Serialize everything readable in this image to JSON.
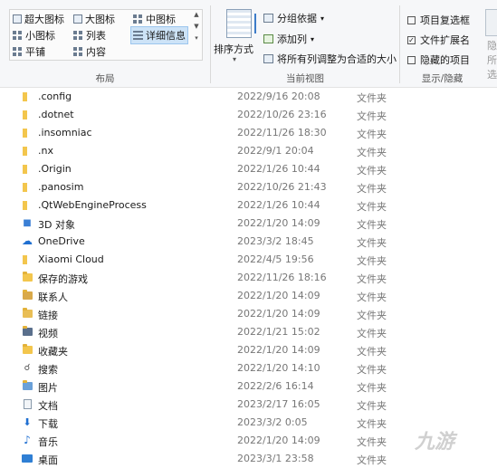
{
  "ribbon": {
    "layout": {
      "group_label": "布局",
      "options": [
        {
          "label": "超大图标",
          "icon": "extra-large-icons-icon"
        },
        {
          "label": "大图标",
          "icon": "large-icons-icon"
        },
        {
          "label": "中图标",
          "icon": "medium-icons-icon"
        },
        {
          "label": "小图标",
          "icon": "small-icons-icon"
        },
        {
          "label": "列表",
          "icon": "list-view-icon"
        },
        {
          "label": "详细信息",
          "icon": "details-view-icon",
          "selected": true
        },
        {
          "label": "平铺",
          "icon": "tiles-view-icon"
        },
        {
          "label": "内容",
          "icon": "content-view-icon"
        }
      ]
    },
    "current_view": {
      "group_label": "当前视图",
      "sort_label": "排序方式",
      "group_by_label": "分组依据",
      "add_column_label": "添加列",
      "fit_columns_label": "将所有列调整为合适的大小"
    },
    "show_hide": {
      "group_label": "显示/隐藏",
      "item_checkboxes_label": "项目复选框",
      "item_checkboxes_checked": false,
      "file_extensions_label": "文件扩展名",
      "file_extensions_checked": true,
      "hidden_items_label": "隐藏的项目",
      "hidden_items_checked": false,
      "hide_selected_label": "隐",
      "selected_items_label": "所选"
    }
  },
  "files": [
    {
      "name": ".config",
      "date": "2022/9/16 20:08",
      "type": "文件夹",
      "icon": "folder-icon"
    },
    {
      "name": ".dotnet",
      "date": "2022/10/26 23:16",
      "type": "文件夹",
      "icon": "folder-icon"
    },
    {
      "name": ".insomniac",
      "date": "2022/11/26 18:30",
      "type": "文件夹",
      "icon": "folder-icon"
    },
    {
      "name": ".nx",
      "date": "2022/9/1 20:04",
      "type": "文件夹",
      "icon": "folder-icon"
    },
    {
      "name": ".Origin",
      "date": "2022/1/26 10:44",
      "type": "文件夹",
      "icon": "folder-icon"
    },
    {
      "name": ".panosim",
      "date": "2022/10/26 21:43",
      "type": "文件夹",
      "icon": "folder-icon"
    },
    {
      "name": ".QtWebEngineProcess",
      "date": "2022/1/26 10:44",
      "type": "文件夹",
      "icon": "folder-icon"
    },
    {
      "name": "3D 对象",
      "date": "2022/1/20 14:09",
      "type": "文件夹",
      "icon": "3d-objects-icon"
    },
    {
      "name": "OneDrive",
      "date": "2023/3/2 18:45",
      "type": "文件夹",
      "icon": "onedrive-cloud-icon"
    },
    {
      "name": "Xiaomi Cloud",
      "date": "2022/4/5 19:56",
      "type": "文件夹",
      "icon": "folder-icon"
    },
    {
      "name": "保存的游戏",
      "date": "2022/11/26 18:16",
      "type": "文件夹",
      "icon": "saved-games-icon"
    },
    {
      "name": "联系人",
      "date": "2022/1/20 14:09",
      "type": "文件夹",
      "icon": "contacts-icon"
    },
    {
      "name": "链接",
      "date": "2022/1/20 14:09",
      "type": "文件夹",
      "icon": "links-icon"
    },
    {
      "name": "视频",
      "date": "2022/1/21 15:02",
      "type": "文件夹",
      "icon": "videos-icon"
    },
    {
      "name": "收藏夹",
      "date": "2022/1/20 14:09",
      "type": "文件夹",
      "icon": "favorites-icon"
    },
    {
      "name": "搜索",
      "date": "2022/1/20 14:10",
      "type": "文件夹",
      "icon": "searches-icon"
    },
    {
      "name": "图片",
      "date": "2022/2/6 16:14",
      "type": "文件夹",
      "icon": "pictures-icon"
    },
    {
      "name": "文档",
      "date": "2023/2/17 16:05",
      "type": "文件夹",
      "icon": "documents-icon"
    },
    {
      "name": "下载",
      "date": "2023/3/2 0:05",
      "type": "文件夹",
      "icon": "downloads-icon"
    },
    {
      "name": "音乐",
      "date": "2022/1/20 14:09",
      "type": "文件夹",
      "icon": "music-icon"
    },
    {
      "name": "桌面",
      "date": "2023/3/1 23:58",
      "type": "文件夹",
      "icon": "desktop-icon"
    }
  ],
  "watermark": "九游"
}
